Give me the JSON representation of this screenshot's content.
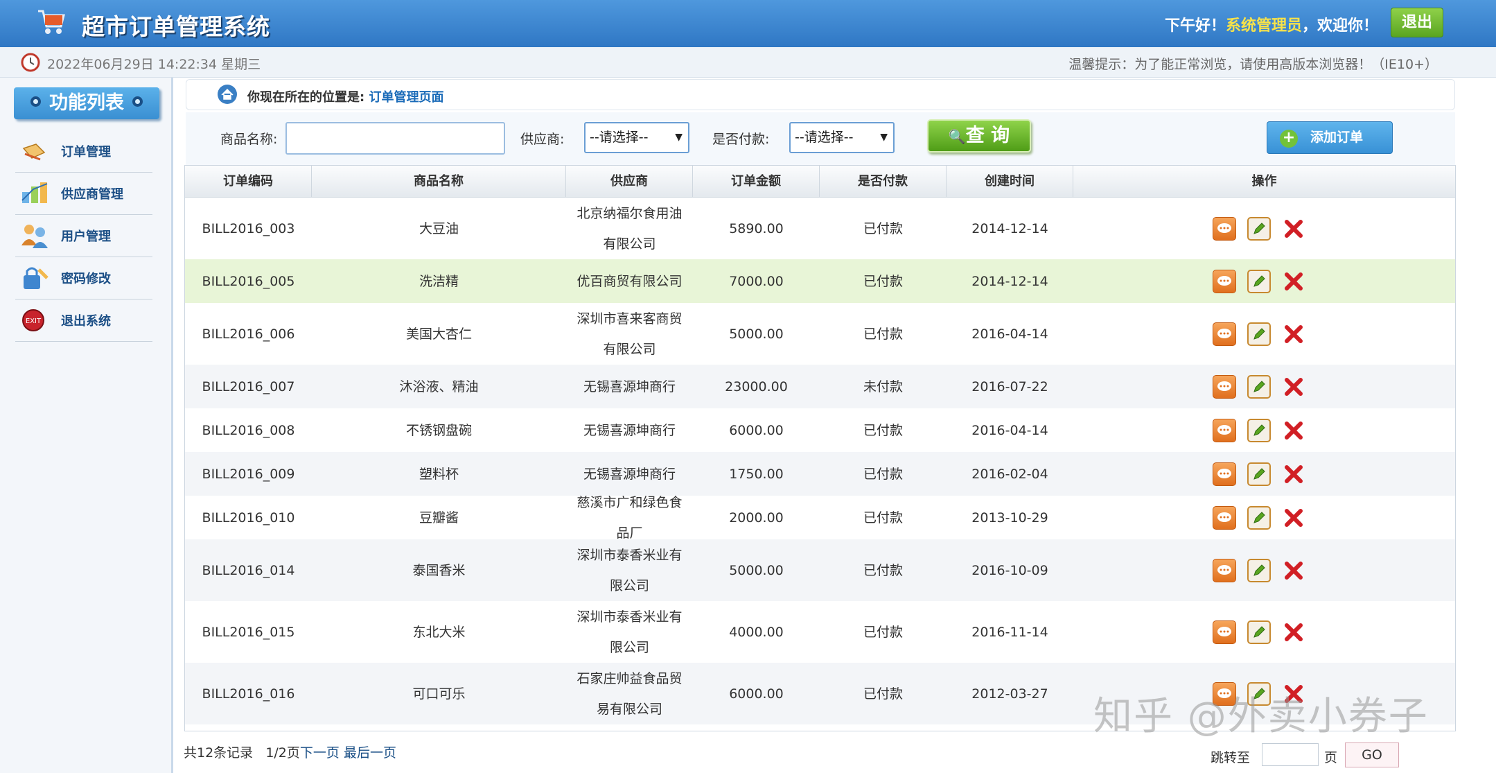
{
  "header": {
    "title": "超市订单管理系统",
    "greeting_prefix": "下午好！",
    "user_role": "系统管理员",
    "greeting_suffix": "，欢迎你！",
    "logout_label": "退出"
  },
  "timebar": {
    "datetime": "2022年06月29日 14:22:34 星期三",
    "tip": "温馨提示：为了能正常浏览，请使用高版本浏览器！（IE10+）"
  },
  "sidebar": {
    "title": "功能列表",
    "items": [
      {
        "label": "订单管理",
        "icon": "order-icon"
      },
      {
        "label": "供应商管理",
        "icon": "supplier-icon"
      },
      {
        "label": "用户管理",
        "icon": "users-icon"
      },
      {
        "label": "密码修改",
        "icon": "password-icon"
      },
      {
        "label": "退出系统",
        "icon": "exit-icon"
      }
    ]
  },
  "breadcrumb": {
    "prefix": "你现在所在的位置是:",
    "current": "订单管理页面"
  },
  "search": {
    "product_label": "商品名称:",
    "product_value": "",
    "supplier_label": "供应商:",
    "supplier_selected": "--请选择--",
    "paid_label": "是否付款:",
    "paid_selected": "--请选择--",
    "query_label": "查 询",
    "add_label": "添加订单"
  },
  "table": {
    "columns": [
      "订单编码",
      "商品名称",
      "供应商",
      "订单金额",
      "是否付款",
      "创建时间",
      "操作"
    ],
    "rows": [
      {
        "code": "BILL2016_003",
        "product": "大豆油",
        "supplier": "北京纳福尔食用油有限公司",
        "amount": "5890.00",
        "paid": "已付款",
        "date": "2014-12-14"
      },
      {
        "code": "BILL2016_005",
        "product": "洗洁精",
        "supplier": "优百商贸有限公司",
        "amount": "7000.00",
        "paid": "已付款",
        "date": "2014-12-14"
      },
      {
        "code": "BILL2016_006",
        "product": "美国大杏仁",
        "supplier": "深圳市喜来客商贸有限公司",
        "amount": "5000.00",
        "paid": "已付款",
        "date": "2016-04-14"
      },
      {
        "code": "BILL2016_007",
        "product": "沐浴液、精油",
        "supplier": "无锡喜源坤商行",
        "amount": "23000.00",
        "paid": "未付款",
        "date": "2016-07-22"
      },
      {
        "code": "BILL2016_008",
        "product": "不锈钢盘碗",
        "supplier": "无锡喜源坤商行",
        "amount": "6000.00",
        "paid": "已付款",
        "date": "2016-04-14"
      },
      {
        "code": "BILL2016_009",
        "product": "塑料杯",
        "supplier": "无锡喜源坤商行",
        "amount": "1750.00",
        "paid": "已付款",
        "date": "2016-02-04"
      },
      {
        "code": "BILL2016_010",
        "product": "豆瓣酱",
        "supplier": "慈溪市广和绿色食品厂",
        "amount": "2000.00",
        "paid": "已付款",
        "date": "2013-10-29"
      },
      {
        "code": "BILL2016_014",
        "product": "泰国香米",
        "supplier": "深圳市泰香米业有限公司",
        "amount": "5000.00",
        "paid": "已付款",
        "date": "2016-10-09"
      },
      {
        "code": "BILL2016_015",
        "product": "东北大米",
        "supplier": "深圳市泰香米业有限公司",
        "amount": "4000.00",
        "paid": "已付款",
        "date": "2016-11-14"
      },
      {
        "code": "BILL2016_016",
        "product": "可口可乐",
        "supplier": "石家庄帅益食品贸易有限公司",
        "amount": "6000.00",
        "paid": "已付款",
        "date": "2012-03-27"
      }
    ]
  },
  "pagination": {
    "total": "共12条记录",
    "page": "1/2页",
    "next": "下一页",
    "last": "最后一页",
    "jump_label": "跳转至",
    "unit": "页",
    "go": "GO"
  },
  "watermark": "知乎 @外卖小券子"
}
